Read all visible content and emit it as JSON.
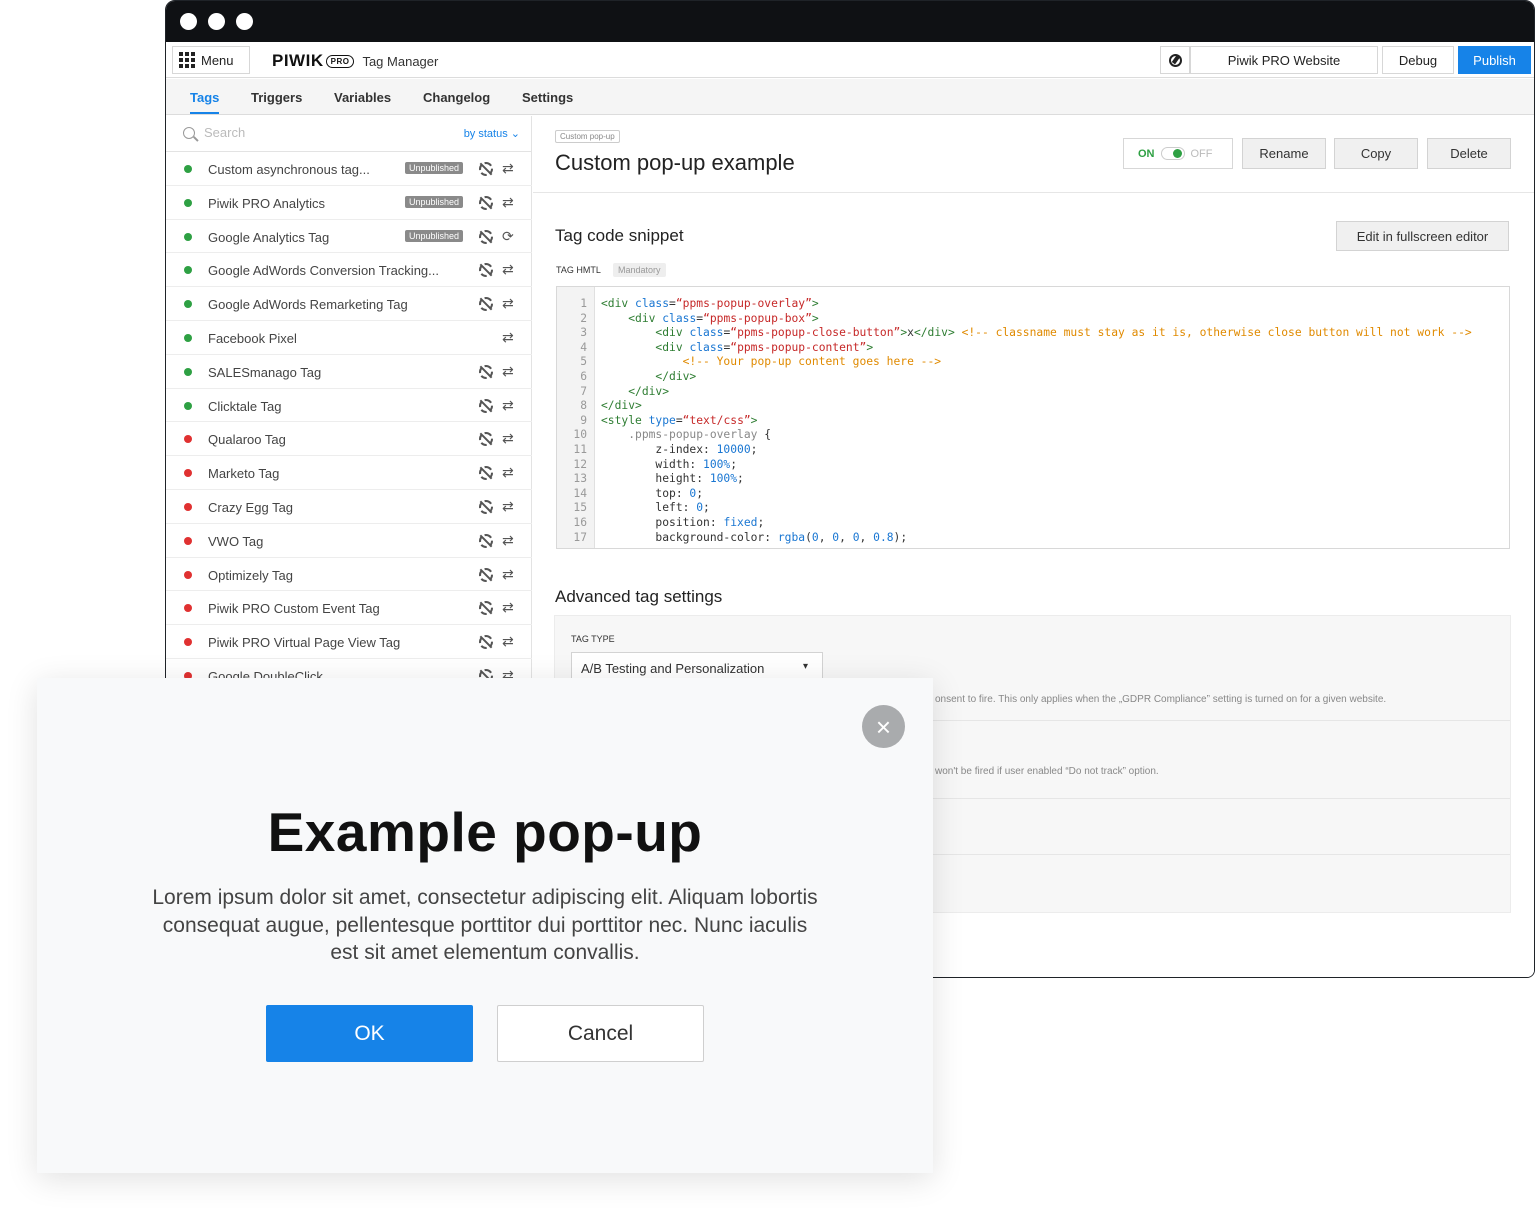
{
  "app": {
    "menu_label": "Menu",
    "logo_text": "PIWIK",
    "logo_pro": "PRO",
    "product_name": "Tag Manager",
    "site_name": "Piwik PRO Website",
    "debug_label": "Debug",
    "publish_label": "Publish"
  },
  "tabs": [
    {
      "label": "Tags",
      "active": true
    },
    {
      "label": "Triggers"
    },
    {
      "label": "Variables"
    },
    {
      "label": "Changelog"
    },
    {
      "label": "Settings"
    }
  ],
  "search": {
    "placeholder": "Search",
    "filter_label": "by status"
  },
  "tags": [
    {
      "name": "Custom asynchronous tag...",
      "status": "green",
      "badge": "Unpublished",
      "icons": [
        "gear",
        "swap"
      ]
    },
    {
      "name": "Piwik PRO Analytics",
      "status": "green",
      "badge": "Unpublished",
      "icons": [
        "gear",
        "swap"
      ]
    },
    {
      "name": "Google Analytics Tag",
      "status": "green",
      "badge": "Unpublished",
      "icons": [
        "gear",
        "refresh"
      ]
    },
    {
      "name": "Google AdWords Conversion Tracking...",
      "status": "green",
      "icons": [
        "gear",
        "swap"
      ]
    },
    {
      "name": "Google AdWords Remarketing Tag",
      "status": "green",
      "icons": [
        "gear",
        "swap"
      ]
    },
    {
      "name": "Facebook Pixel",
      "status": "green",
      "icons": [
        "swap"
      ]
    },
    {
      "name": "SALESmanago Tag",
      "status": "green",
      "icons": [
        "gear",
        "swap"
      ]
    },
    {
      "name": "Clicktale Tag",
      "status": "green",
      "icons": [
        "gear",
        "swap"
      ]
    },
    {
      "name": "Qualaroo Tag",
      "status": "red",
      "icons": [
        "gear",
        "swap"
      ]
    },
    {
      "name": "Marketo Tag",
      "status": "red",
      "icons": [
        "gear",
        "swap"
      ]
    },
    {
      "name": "Crazy Egg Tag",
      "status": "red",
      "icons": [
        "gear",
        "swap"
      ]
    },
    {
      "name": "VWO Tag",
      "status": "red",
      "icons": [
        "gear",
        "swap"
      ]
    },
    {
      "name": "Optimizely Tag",
      "status": "red",
      "icons": [
        "gear",
        "swap"
      ]
    },
    {
      "name": "Piwik PRO Custom Event Tag",
      "status": "red",
      "icons": [
        "gear",
        "swap"
      ]
    },
    {
      "name": "Piwik PRO Virtual Page View Tag",
      "status": "red",
      "icons": [
        "gear",
        "swap"
      ]
    },
    {
      "name": "Google DoubleClick",
      "status": "red",
      "icons": [
        "gear",
        "swap"
      ]
    }
  ],
  "colors": {
    "green": "#2ea043",
    "red": "#e03131",
    "accent": "#1683e8"
  },
  "detail": {
    "breadcrumb": "Custom pop-up",
    "title": "Custom pop-up example",
    "toggle_on": "ON",
    "toggle_off": "OFF",
    "rename_label": "Rename",
    "copy_label": "Copy",
    "delete_label": "Delete",
    "snippet_title": "Tag code snippet",
    "fullscreen_label": "Edit in fullscreen editor",
    "tag_html_label": "TAG HMTL",
    "mandatory_label": "Mandatory",
    "advanced_title": "Advanced tag settings",
    "tag_type_label": "TAG TYPE",
    "tag_type_value": "A/B Testing and Personalization",
    "gdpr_note": "onsent to fire. This only applies when the „GDPR Compliance” setting is turned on for a given website.",
    "dnt_note": "won't be fired if user enabled “Do not track” option."
  },
  "code_line_numbers": [
    "1",
    "2",
    "3",
    "4",
    "5",
    "6",
    "7",
    "8",
    "9",
    "10",
    "11",
    "12",
    "13",
    "14",
    "15",
    "16",
    "17"
  ],
  "popup": {
    "title": "Example pop-up",
    "body": "Lorem ipsum dolor sit amet, consectetur adipiscing elit. Aliquam lobortis consequat augue, pellentesque porttitor dui porttitor nec. Nunc iaculis est sit amet elementum convallis.",
    "ok_label": "OK",
    "cancel_label": "Cancel",
    "close_glyph": "×"
  }
}
